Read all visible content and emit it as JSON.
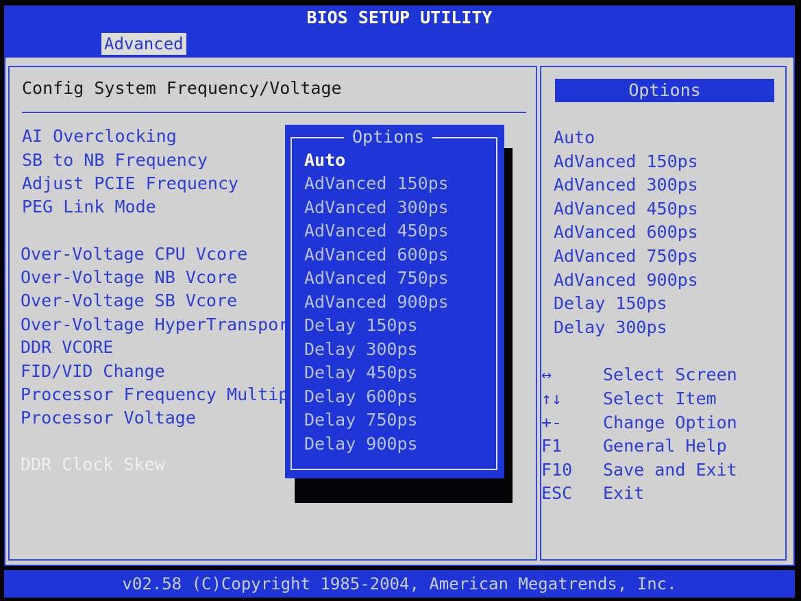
{
  "title": "BIOS SETUP UTILITY",
  "tabs": [
    {
      "label": "Advanced",
      "active": true
    }
  ],
  "section_title": "Config System Frequency/Voltage",
  "menu_items": [
    {
      "label": "AI Overclocking",
      "enabled": true
    },
    {
      "label": "SB to NB Frequency",
      "enabled": true
    },
    {
      "label": "Adjust PCIE Frequency",
      "enabled": true
    },
    {
      "label": "PEG Link Mode",
      "enabled": true
    },
    {
      "label": "Over-Voltage CPU Vcore",
      "enabled": true
    },
    {
      "label": "Over-Voltage NB Vcore",
      "enabled": true
    },
    {
      "label": "Over-Voltage SB Vcore",
      "enabled": true
    },
    {
      "label": "Over-Voltage HyperTransport",
      "enabled": true
    },
    {
      "label": "DDR VCORE",
      "enabled": true
    },
    {
      "label": "FID/VID Change",
      "enabled": true
    },
    {
      "label": "Processor Frequency Multipl",
      "enabled": true
    },
    {
      "label": "Processor Voltage",
      "enabled": true
    },
    {
      "label": "DDR Clock Skew",
      "enabled": false
    }
  ],
  "popup": {
    "title": "Options",
    "selected_index": 0,
    "options": [
      "Auto",
      "AdVanced 150ps",
      "AdVanced 300ps",
      "AdVanced 450ps",
      "AdVanced 600ps",
      "AdVanced 750ps",
      "AdVanced 900ps",
      "Delay 150ps",
      "Delay 300ps",
      "Delay 450ps",
      "Delay 600ps",
      "Delay 750ps",
      "Delay 900ps"
    ]
  },
  "right_panel": {
    "header": "Options",
    "options": [
      "Auto",
      "AdVanced 150ps",
      "AdVanced 300ps",
      "AdVanced 450ps",
      "AdVanced 600ps",
      "AdVanced 750ps",
      "AdVanced 900ps",
      "Delay 150ps",
      "Delay 300ps"
    ],
    "help": [
      {
        "key": "↔",
        "desc": "Select Screen"
      },
      {
        "key": "↑↓",
        "desc": "Select Item"
      },
      {
        "key": "+-",
        "desc": "Change Option"
      },
      {
        "key": "F1",
        "desc": "General Help"
      },
      {
        "key": "F10",
        "desc": "Save and Exit"
      },
      {
        "key": "ESC",
        "desc": "Exit"
      }
    ]
  },
  "footer": "v02.58 (C)Copyright 1985-2004, American Megatrends, Inc.",
  "colors": {
    "bios_blue": "#1f35d6",
    "panel_gray": "#d0d1d0",
    "text_blue": "#2c3ed6"
  }
}
